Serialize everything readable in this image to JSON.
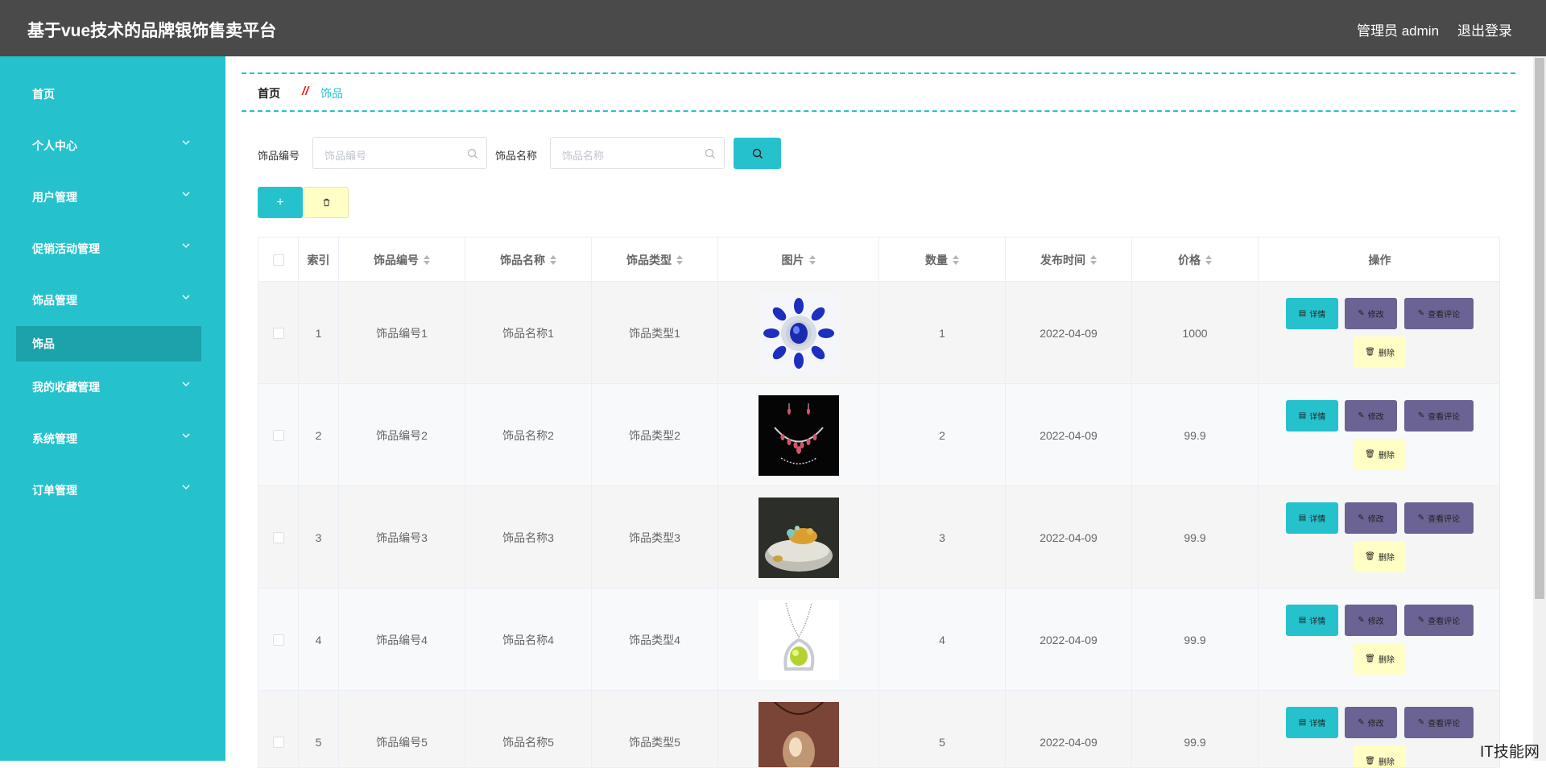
{
  "header": {
    "app_title": "基于vue技术的品牌银饰售卖平台",
    "user": "管理员 admin",
    "logout": "退出登录"
  },
  "sidebar": {
    "items": [
      {
        "label": "首页",
        "has_children": false,
        "active": false
      },
      {
        "label": "个人中心",
        "has_children": true,
        "active": false
      },
      {
        "label": "用户管理",
        "has_children": true,
        "active": false
      },
      {
        "label": "促销活动管理",
        "has_children": true,
        "active": false
      },
      {
        "label": "饰品管理",
        "has_children": true,
        "active": false
      },
      {
        "label": "饰品",
        "has_children": false,
        "active": true
      },
      {
        "label": "我的收藏管理",
        "has_children": true,
        "active": false
      },
      {
        "label": "系统管理",
        "has_children": true,
        "active": false
      },
      {
        "label": "订单管理",
        "has_children": true,
        "active": false
      }
    ]
  },
  "breadcrumb": {
    "home": "首页",
    "separator": "//",
    "current": "饰品"
  },
  "search": {
    "code_label": "饰品编号",
    "code_placeholder": "饰品编号",
    "name_label": "饰品名称",
    "name_placeholder": "饰品名称"
  },
  "toolbar": {
    "add_label": "+"
  },
  "table": {
    "columns": {
      "index": "索引",
      "code": "饰品编号",
      "name": "饰品名称",
      "type": "饰品类型",
      "image": "图片",
      "quantity": "数量",
      "published": "发布时间",
      "price": "价格",
      "actions": "操作"
    },
    "rows": [
      {
        "index": "1",
        "code": "饰品编号1",
        "name": "饰品名称1",
        "type": "饰品类型1",
        "quantity": "1",
        "published": "2022-04-09",
        "price": "1000",
        "image": "blue-jeweled-brooch"
      },
      {
        "index": "2",
        "code": "饰品编号2",
        "name": "饰品名称2",
        "type": "饰品类型2",
        "quantity": "2",
        "published": "2022-04-09",
        "price": "99.9",
        "image": "necklace-earrings-set"
      },
      {
        "index": "3",
        "code": "饰品编号3",
        "name": "饰品名称3",
        "type": "饰品类型3",
        "quantity": "3",
        "published": "2022-04-09",
        "price": "99.9",
        "image": "gold-ornament-bowl"
      },
      {
        "index": "4",
        "code": "饰品编号4",
        "name": "饰品名称4",
        "type": "饰品类型4",
        "quantity": "4",
        "published": "2022-04-09",
        "price": "99.9",
        "image": "green-gem-pendant"
      },
      {
        "index": "5",
        "code": "饰品编号5",
        "name": "饰品名称5",
        "type": "饰品类型5",
        "quantity": "5",
        "published": "2022-04-09",
        "price": "99.9",
        "image": "crystal-pendant"
      }
    ],
    "action_labels": {
      "detail": "详情",
      "edit": "修改",
      "review": "查看评论",
      "delete": "删除"
    }
  },
  "watermark": "IT技能网",
  "colors": {
    "header_bg": "#4a4a4a",
    "sidebar_bg": "#25c2cd",
    "accent": "#25c2cd",
    "edit_btn": "#6a6393",
    "delete_btn": "#fffec4"
  }
}
